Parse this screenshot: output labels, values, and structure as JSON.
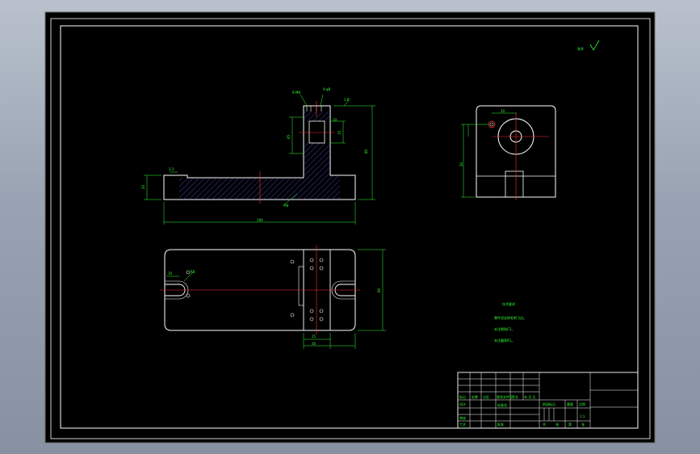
{
  "drawing": {
    "surface_roughness_note": "其余",
    "tech_requirements": {
      "title": "技术要求",
      "lines": [
        "零件须去除毛刺飞边。",
        "未注倒角C1。",
        "未注圆角R1。"
      ]
    },
    "dimensions": {
      "overall_length": "190",
      "overall_height": "80",
      "base_height": "20",
      "width": "60",
      "right_width": "30",
      "rib_width": "15",
      "hole_pos": "10",
      "slot_radius": "R8",
      "top_note_1": "6-M6",
      "top_note_2": "4-φ8",
      "roughness_a": "1.6",
      "roughness_b": "3.2",
      "top_view_h": "50",
      "side_h": "65"
    },
    "title_block": {
      "rows_left": [
        "标记",
        "设计",
        "审核",
        "工艺"
      ],
      "cells_mid": [
        "处数",
        "分区",
        "更改文件号",
        "签名",
        "年.月.日"
      ],
      "labels": [
        "标准化",
        "批准",
        "阶段标记",
        "重量",
        "比例"
      ],
      "scale": "1:1",
      "sheet": [
        "共",
        "张",
        "第",
        "张"
      ]
    }
  },
  "colors": {
    "background": "#000000",
    "lines": "#ffffff",
    "dimensions": "#33ff33",
    "centerlines": "#ff3333",
    "hatch": "#4444ff"
  }
}
